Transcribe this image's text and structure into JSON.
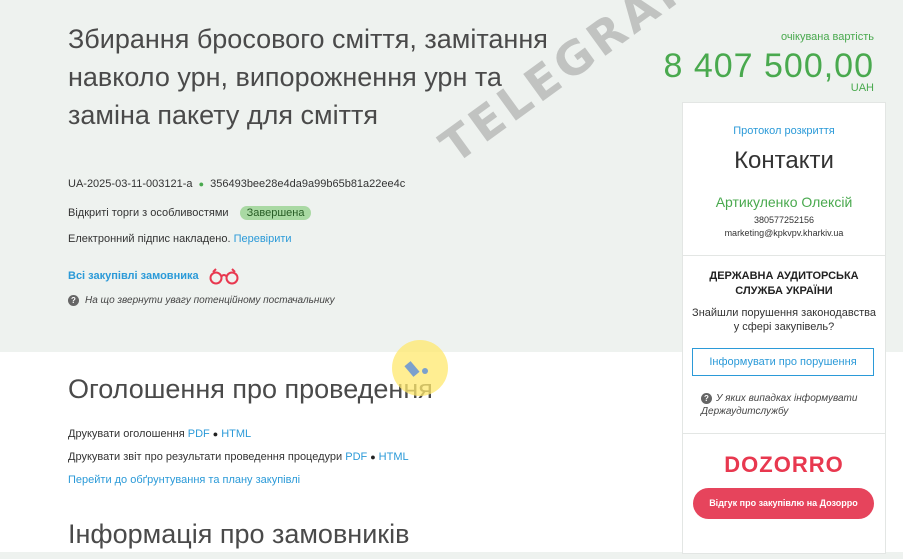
{
  "tender": {
    "title": "Збирання бросового сміття, замітання навколо урн, випорожнення урн та заміна пакету для сміття",
    "id": "UA-2025-03-11-003121-a",
    "hash": "356493bee28e4da9a99b65b81a22ee4c",
    "procedure_type": "Відкриті торги з особливостями",
    "status": "Завершена",
    "signature_text": "Електронний підпис накладено.",
    "verify_link": "Перевірити",
    "all_purchases_link": "Всі закупівлі замовника",
    "help_text": "На що звернути увагу потенційному постачальнику"
  },
  "price": {
    "label": "очікувана вартість",
    "amount": "8 407 500,00",
    "currency": "UAH"
  },
  "sidebar": {
    "protocol_link": "Протокол розкриття",
    "contacts_title": "Контакти",
    "contact_name": "Артикуленко Олексій",
    "contact_phone": "380577252156",
    "contact_email": "marketing@kpkvpv.kharkiv.ua",
    "audit_title": "ДЕРЖАВНА АУДИТОРСЬКА СЛУЖБА УКРАЇНИ",
    "audit_question": "Знайшли порушення законодавства у сфері закупівель?",
    "report_button": "Інформувати про порушення",
    "audit_help": "У яких випадках інформувати Держаудитслужбу",
    "dozorro_logo": "DOZORRO",
    "dozorro_button": "Відгук про закупівлю на Дозорро"
  },
  "announcement": {
    "heading": "Оголошення про проведення",
    "print_announcement": "Друкувати оголошення",
    "print_report": "Друкувати звіт про результати проведення процедури",
    "pdf": "PDF",
    "html": "HTML",
    "goto_plan": "Перейти до обґрунтування та плану закупівлі"
  },
  "customers": {
    "heading": "Інформація про замовників"
  },
  "watermark": {
    "text": "TELEGRAF"
  },
  "colors": {
    "accent_green": "#49a94e",
    "link_blue": "#2b9ad8",
    "dozorro_red": "#e6445c",
    "header_bg": "#eef2ef"
  }
}
